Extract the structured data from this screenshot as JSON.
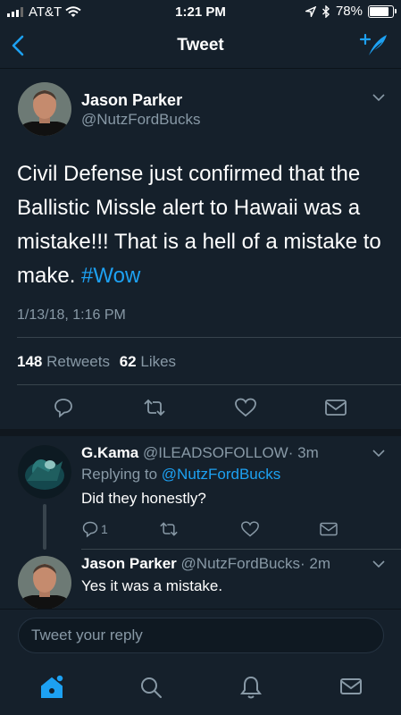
{
  "status": {
    "carrier": "AT&T",
    "time": "1:21 PM",
    "battery": "78%"
  },
  "nav": {
    "title": "Tweet"
  },
  "tweet": {
    "name": "Jason Parker",
    "handle": "@NutzFordBucks",
    "text_prefix": "Civil Defense just confirmed that the Ballistic Missle alert to Hawaii was a mistake!!! That is a hell of a mistake to make. ",
    "hashtag": "#Wow",
    "timestamp": "1/13/18, 1:16 PM",
    "retweets": "148",
    "retweets_label": "Retweets",
    "likes": "62",
    "likes_label": "Likes"
  },
  "replies": [
    {
      "name": "G.Kama",
      "handle": "@ILEADSOFOLLOW",
      "time": "· 3m",
      "replying_label": "Replying to",
      "replying_to": "@NutzFordBucks",
      "text": "Did they honestly?",
      "reply_count": "1"
    },
    {
      "name": "Jason Parker",
      "handle": "@NutzFordBucks",
      "time": "· 2m",
      "text": "Yes it was a mistake."
    }
  ],
  "reply_input": {
    "placeholder": "Tweet your reply"
  },
  "colors": {
    "background": "#15202b",
    "accent": "#1da1f2",
    "muted": "#8899a6"
  }
}
